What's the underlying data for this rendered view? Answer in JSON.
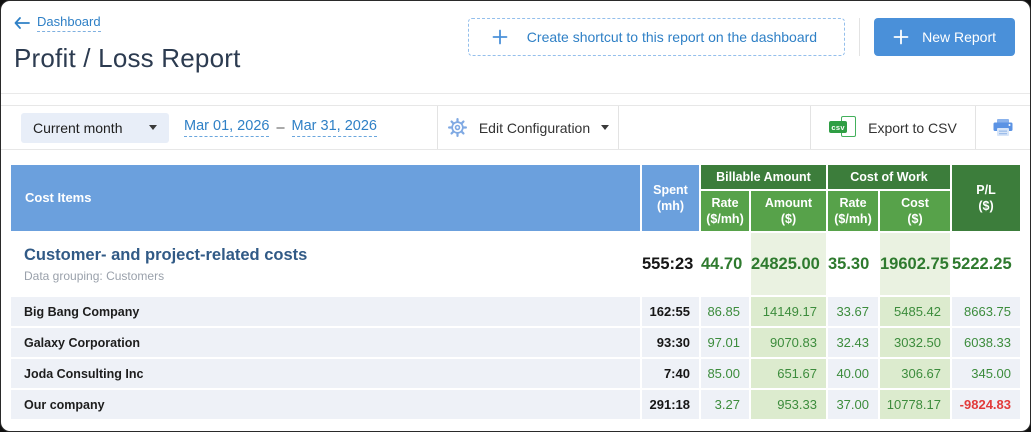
{
  "header": {
    "back_link": "Dashboard",
    "title": "Profit / Loss Report",
    "shortcut_button": "Create shortcut to this report on the dashboard",
    "new_report_button": "New Report"
  },
  "toolbar": {
    "period_selected": "Current month",
    "date_from": "Mar 01, 2026",
    "date_separator": "–",
    "date_to": "Mar 31, 2026",
    "edit_configuration": "Edit Configuration",
    "export_csv": "Export to CSV",
    "csv_icon_label": "csv"
  },
  "table": {
    "header": {
      "cost_items": "Cost Items",
      "spent": {
        "l1": "Spent",
        "l2": "(mh)"
      },
      "billable_amount_group": "Billable Amount",
      "cost_of_work_group": "Cost of Work",
      "billable_rate": {
        "l1": "Rate",
        "l2": "($/mh)"
      },
      "billable_amount": {
        "l1": "Amount",
        "l2": "($)"
      },
      "cost_rate": {
        "l1": "Rate",
        "l2": "($/mh)"
      },
      "cost": {
        "l1": "Cost",
        "l2": "($)"
      },
      "pl": {
        "l1": "P/L",
        "l2": "($)"
      }
    },
    "summary": {
      "name": "Customer- and project-related costs",
      "grouping_label": "Data grouping:",
      "grouping_value": "Customers",
      "spent": "555:23",
      "billable_rate": "44.70",
      "billable_amount": "24825.00",
      "cost_rate": "35.30",
      "cost": "19602.75",
      "pl": "5222.25"
    },
    "rows": [
      {
        "name": "Big Bang Company",
        "spent": "162:55",
        "billable_rate": "86.85",
        "billable_amount": "14149.17",
        "cost_rate": "33.67",
        "cost": "5485.42",
        "pl": "8663.75"
      },
      {
        "name": "Galaxy Corporation",
        "spent": "93:30",
        "billable_rate": "97.01",
        "billable_amount": "9070.83",
        "cost_rate": "32.43",
        "cost": "3032.50",
        "pl": "6038.33"
      },
      {
        "name": "Joda Consulting Inc",
        "spent": "7:40",
        "billable_rate": "85.00",
        "billable_amount": "651.67",
        "cost_rate": "40.00",
        "cost": "306.67",
        "pl": "345.00"
      },
      {
        "name": "Our company",
        "spent": "291:18",
        "billable_rate": "3.27",
        "billable_amount": "953.33",
        "cost_rate": "37.00",
        "cost": "10778.17",
        "pl": "-9824.83"
      }
    ]
  },
  "colors": {
    "header_blue": "#6ba0dd",
    "group_green_dark": "#3c7d3b",
    "subheader_green": "#57a24a",
    "cell_green_tint_rows": "#dcebce",
    "cell_green_tint_summary": "#eaf2e1",
    "row_bg": "#eef1f7",
    "value_green": "#3c8c3c",
    "negative_red": "#e23b3b",
    "link_blue": "#2f80c6",
    "button_blue": "#4a90d9"
  }
}
